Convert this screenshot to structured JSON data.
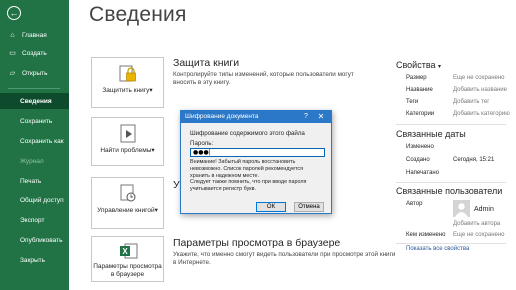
{
  "sidebar": {
    "items": [
      {
        "icon": "home-icon",
        "glyph": "⌂",
        "label": "Главная"
      },
      {
        "icon": "new-document-icon",
        "glyph": "▭",
        "label": "Создать"
      },
      {
        "icon": "open-folder-icon",
        "glyph": "▱",
        "label": "Открыть"
      }
    ],
    "selected": "Сведения",
    "items2": [
      "Сохранить",
      "Сохранить как",
      "Журнал",
      "Печать",
      "Общий доступ",
      "Экспорт",
      "Опубликовать",
      "Закрыть"
    ],
    "disabled": [
      "Журнал"
    ]
  },
  "page": {
    "title": "Сведения"
  },
  "sections": [
    {
      "button_label": "Защитить книгу",
      "button_arrow": "▾",
      "title": "Защита книги",
      "desc": [
        "Контролируйте типы изменений, которые пользователи могут",
        "вносить в эту книгу."
      ]
    },
    {
      "button_label": "Найти проблемы",
      "button_arrow": "▾",
      "title": "",
      "desc": []
    },
    {
      "button_label": "Управление книгой",
      "button_arrow": "▾",
      "title": "Упр",
      "desc": []
    },
    {
      "button_label": "Параметры просмотра в браузере",
      "title": "Параметры просмотра в браузере",
      "desc": [
        "Укажите, что именно смогут видеть пользователи при просмотре этой книги",
        "в Интернете."
      ]
    }
  ],
  "properties": {
    "header": "Свойства",
    "rows": [
      {
        "key": "Размер",
        "value": "Еще не сохранено"
      },
      {
        "key": "Название",
        "value": "Добавить название"
      },
      {
        "key": "Теги",
        "value": "Добавить тег"
      },
      {
        "key": "Категории",
        "value": "Добавить категорию"
      }
    ]
  },
  "related_dates": {
    "header": "Связанные даты",
    "rows": [
      {
        "key": "Изменено",
        "value": ""
      },
      {
        "key": "Создано",
        "value": "Сегодня, 15:21"
      },
      {
        "key": "Напечатано",
        "value": ""
      }
    ]
  },
  "related_people": {
    "header": "Связанные пользователи",
    "author_key": "Автор",
    "author_name": "Admin",
    "add_author": "Добавить автора",
    "last_modified_key": "Кем изменено",
    "last_modified_value": "Еще не сохранено",
    "show_all": "Показать все свойства"
  },
  "dialog": {
    "title": "Шифрование документа",
    "help": "?",
    "close": "✕",
    "subtitle": "Шифрование содержимого этого файла",
    "password_label": "Пароль:",
    "password_value": "●●●|",
    "warning": [
      "Внимание! Забытый пароль восстановить",
      "невозможно. Список паролей рекомендуется",
      "хранить в надежном месте.",
      "Следует также помнить, что при вводе пароля",
      "учитывается регистр букв."
    ],
    "ok": "ОК",
    "cancel": "Отмена"
  },
  "colors": {
    "accent": "#217346",
    "selected": "#0e4a2c",
    "dialog_title": "#2b78c8",
    "link": "#2b579a"
  }
}
